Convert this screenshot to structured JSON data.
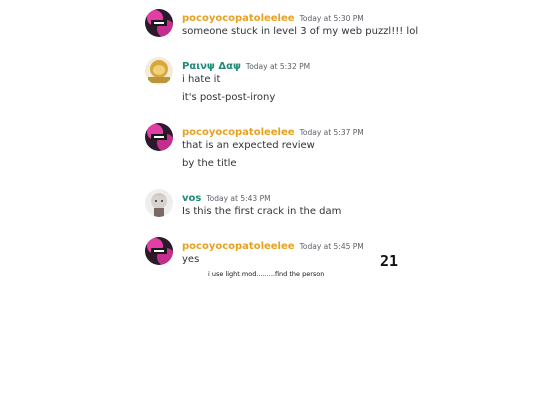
{
  "colors": {
    "author_pink": "#e8a21f",
    "author_teal": "#1f8b77",
    "timestamp": "#5c5e66",
    "text": "#313338"
  },
  "messages": [
    {
      "author": "pocoyocopatoleelee",
      "timestamp": "Today at 5:30 PM",
      "lines": [
        "someone stuck in level 3 of my web puzzl!!! lol"
      ]
    },
    {
      "author": "Ραινψ Δαψ",
      "timestamp": "Today at 5:32 PM",
      "lines": [
        "i hate it",
        "it's post-post-irony"
      ]
    },
    {
      "author": "pocoyocopatoleelee",
      "timestamp": "Today at 5:37 PM",
      "lines": [
        "that is an expected review",
        "by the title"
      ]
    },
    {
      "author": "vos",
      "timestamp": "Today at 5:43 PM",
      "lines": [
        "Is this the first crack in the dam"
      ]
    },
    {
      "author": "pocoyocopatoleelee",
      "timestamp": "Today at 5:45 PM",
      "lines": [
        "yes"
      ]
    }
  ],
  "page_number": "21",
  "caption": "i use light mod.........find the person"
}
